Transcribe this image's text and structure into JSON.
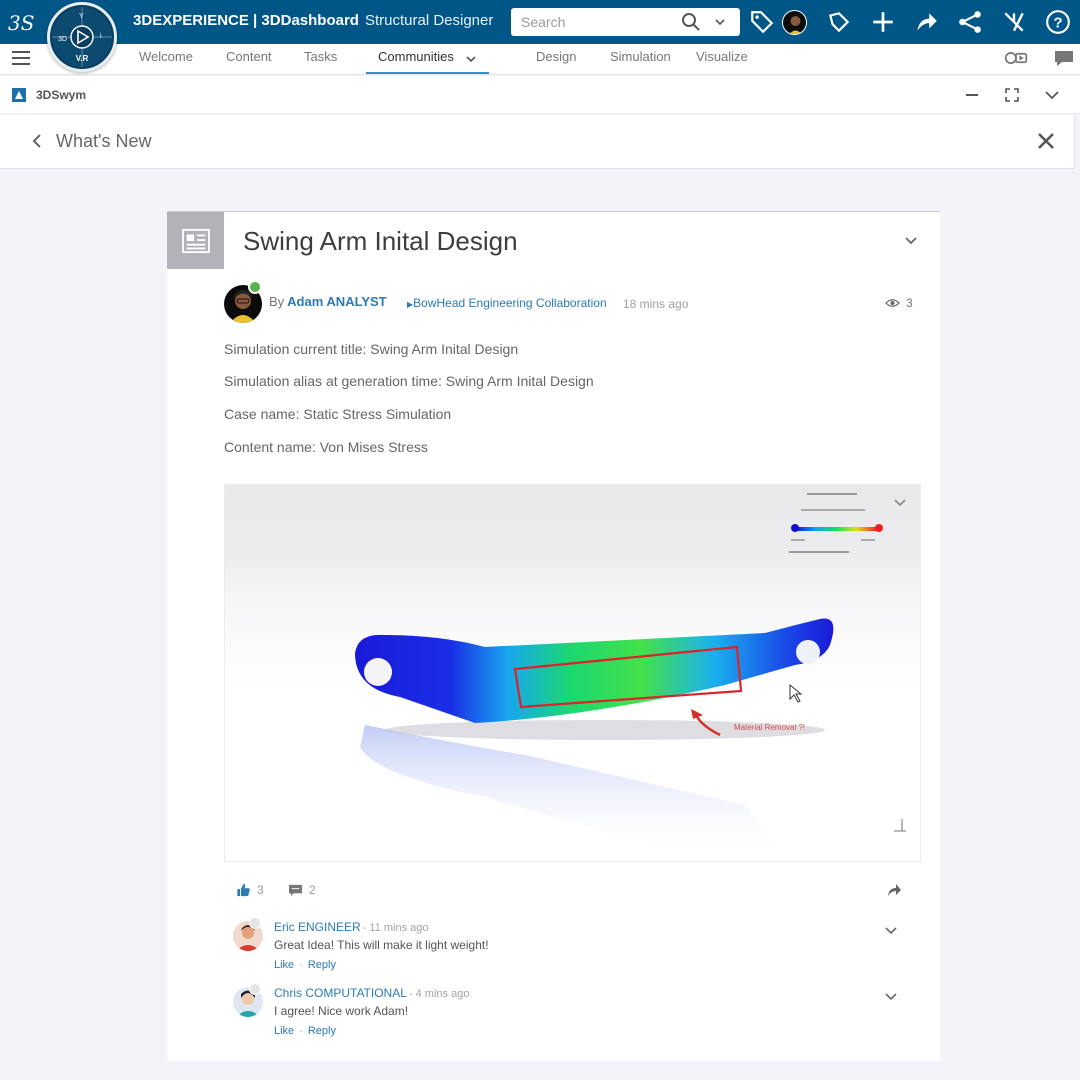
{
  "topbar": {
    "brand_bold_1": "3D",
    "brand_regular_1": "EXPERIENCE | ",
    "brand_bold_2": "3D",
    "brand_regular_2": "Dashboard",
    "app_name": "Structural Designer",
    "search_placeholder": "Search",
    "compass_label": "V.R",
    "compass_3d": "3D",
    "icons": [
      "tag-icon",
      "avatar",
      "label-icon",
      "plus-icon",
      "share-icon",
      "network-icon",
      "community-icon",
      "help-icon"
    ]
  },
  "tabs": {
    "items": [
      {
        "label": "Welcome"
      },
      {
        "label": "Content"
      },
      {
        "label": "Tasks"
      },
      {
        "label": "Communities"
      },
      {
        "label": "Design"
      },
      {
        "label": "Simulation"
      },
      {
        "label": "Visualize"
      }
    ],
    "active": "Communities"
  },
  "widget": {
    "title": "3DSwym"
  },
  "panel": {
    "title": "What's New"
  },
  "post": {
    "title": "Swing Arm Inital Design",
    "by": "By",
    "author": "Adam ANALYST",
    "community": "BowHead Engineering Collaboration",
    "time": "18 mins ago",
    "views": "3",
    "meta": [
      "Simulation current title: Swing Arm Inital Design",
      "Simulation alias at generation time: Swing Arm Inital Design",
      "Case name: Static Stress Simulation",
      "Content name: Von Mises Stress"
    ],
    "annotation": "Material Removal ?!",
    "likes": "3",
    "comments_count": "2"
  },
  "comments": [
    {
      "author": "Eric ENGINEER",
      "time": "- 11 mins ago",
      "text": "Great Idea! This will make it light weight!",
      "like": "Like",
      "reply": "Reply"
    },
    {
      "author": "Chris COMPUTATIONAL",
      "time": "- 4 mins ago",
      "text": "I agree! Nice work Adam!",
      "like": "Like",
      "reply": "Reply"
    }
  ],
  "colors": {
    "topbar": "#005686",
    "link": "#2b7ab5",
    "active_tab_underline": "#368ec4"
  }
}
